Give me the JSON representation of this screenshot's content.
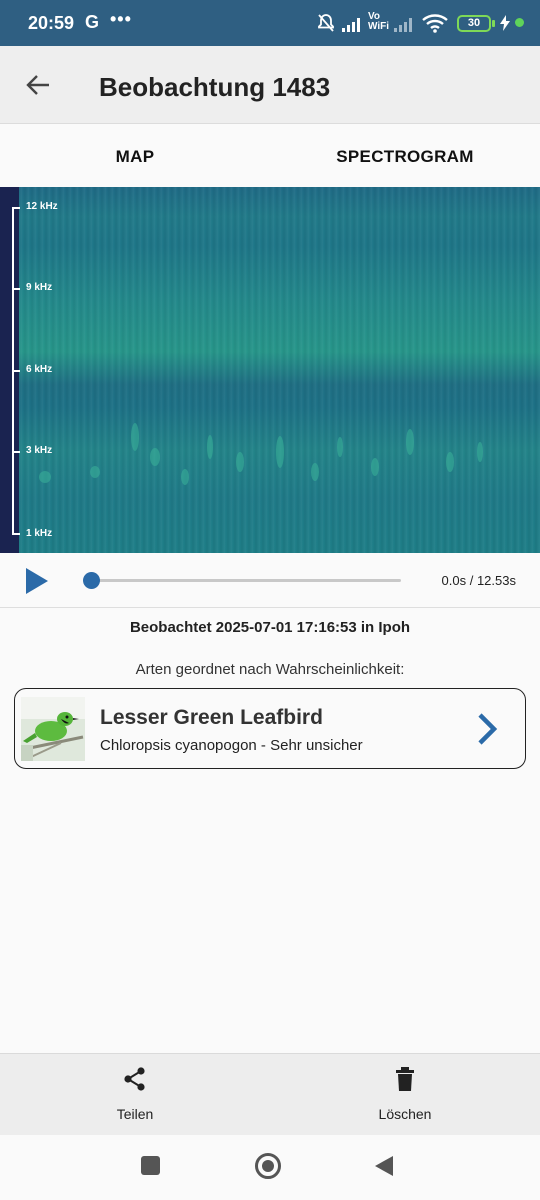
{
  "status_bar": {
    "time": "20:59",
    "g_label": "G",
    "dots": "•••",
    "network_label": "Vo WiFi",
    "battery": "30"
  },
  "app_bar": {
    "title": "Beobachtung 1483",
    "back_icon": "arrow-left-icon"
  },
  "tabs": [
    {
      "label": "MAP"
    },
    {
      "label": "SPECTROGRAM"
    }
  ],
  "spectrogram": {
    "axis_labels": [
      "12 kHz",
      "9 kHz",
      "6 kHz",
      "3 kHz",
      "1 kHz"
    ],
    "colors": {
      "axis": "#1a2350",
      "signal": "#27968a"
    }
  },
  "player": {
    "play_icon": "play-icon",
    "time": "0.0s / 12.53s",
    "progress": 0,
    "accent": "#2b6aa8"
  },
  "observation": {
    "observed_text": "Beobachtet 2025-07-01 17:16:53 in Ipoh",
    "species_heading": "Arten geordnet nach Wahrscheinlichkeit:"
  },
  "species": [
    {
      "common_name": "Lesser Green Leafbird",
      "scientific_line": "Chloropsis cyanopogon - Sehr unsicher",
      "icon": "chevron-right-icon"
    }
  ],
  "actions": {
    "share_label": "Teilen",
    "delete_label": "Löschen"
  }
}
